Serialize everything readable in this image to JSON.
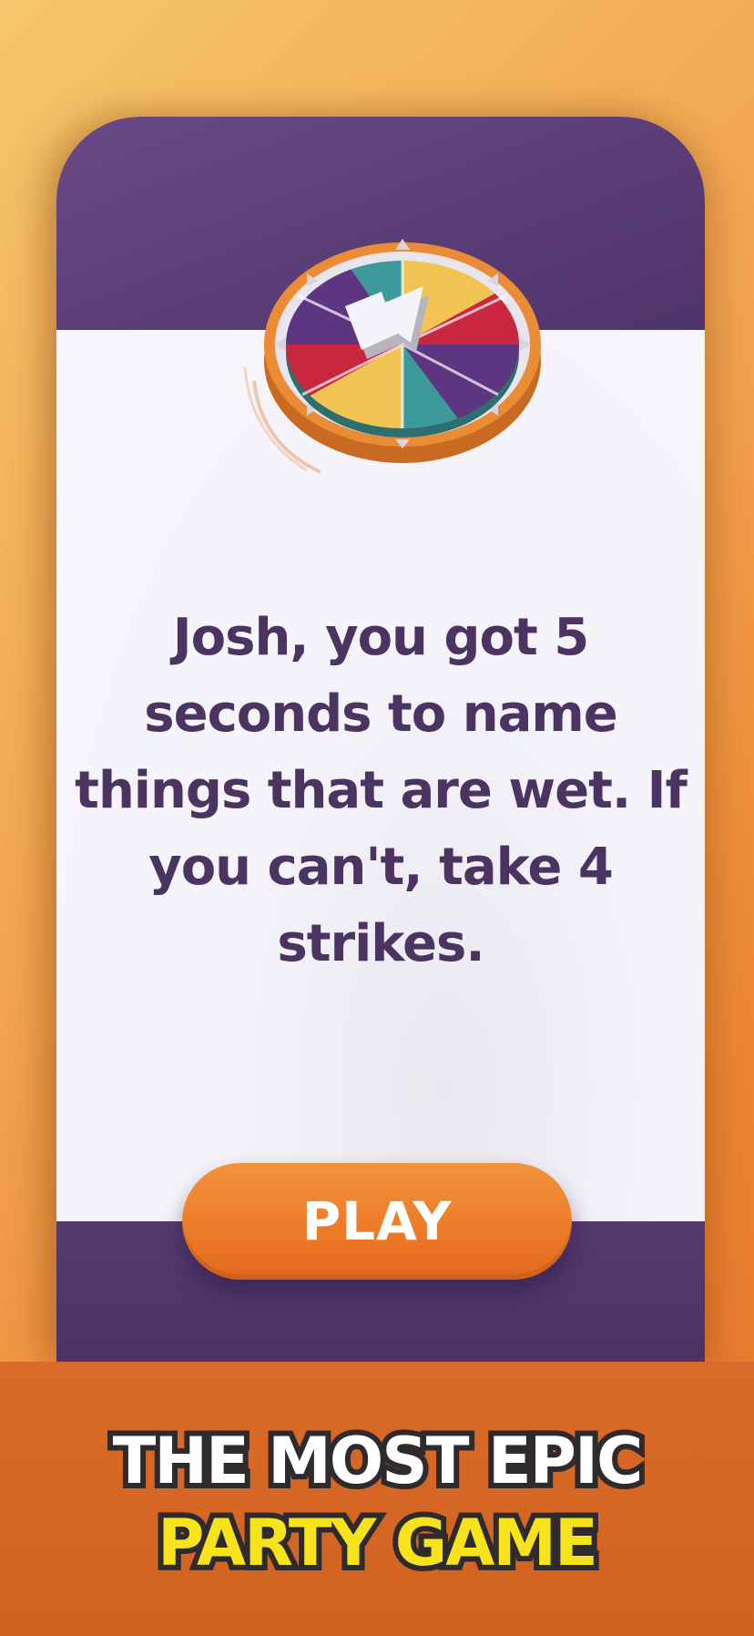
{
  "card": {
    "prompt": "Josh, you got 5 seconds to name things that are wet. If you can't, take 4 strikes.",
    "play_label": "PLAY"
  },
  "wheel": {
    "icon": "spinner-wheel-icon",
    "segment_colors": [
      "#3e9a9a",
      "#f1c352",
      "#c9263f",
      "#5e3580",
      "#3e9a9a",
      "#f1c352",
      "#c9263f",
      "#5e3580"
    ],
    "rim_color": "#ea8c36"
  },
  "banner": {
    "line1": "THE MOST EPIC",
    "line2": "PARTY GAME"
  },
  "colors": {
    "text_purple": "#4b3461",
    "card_purple": "#5a3d76",
    "button_orange": "#ec7a27",
    "tagline_yellow": "#f6e31c"
  }
}
